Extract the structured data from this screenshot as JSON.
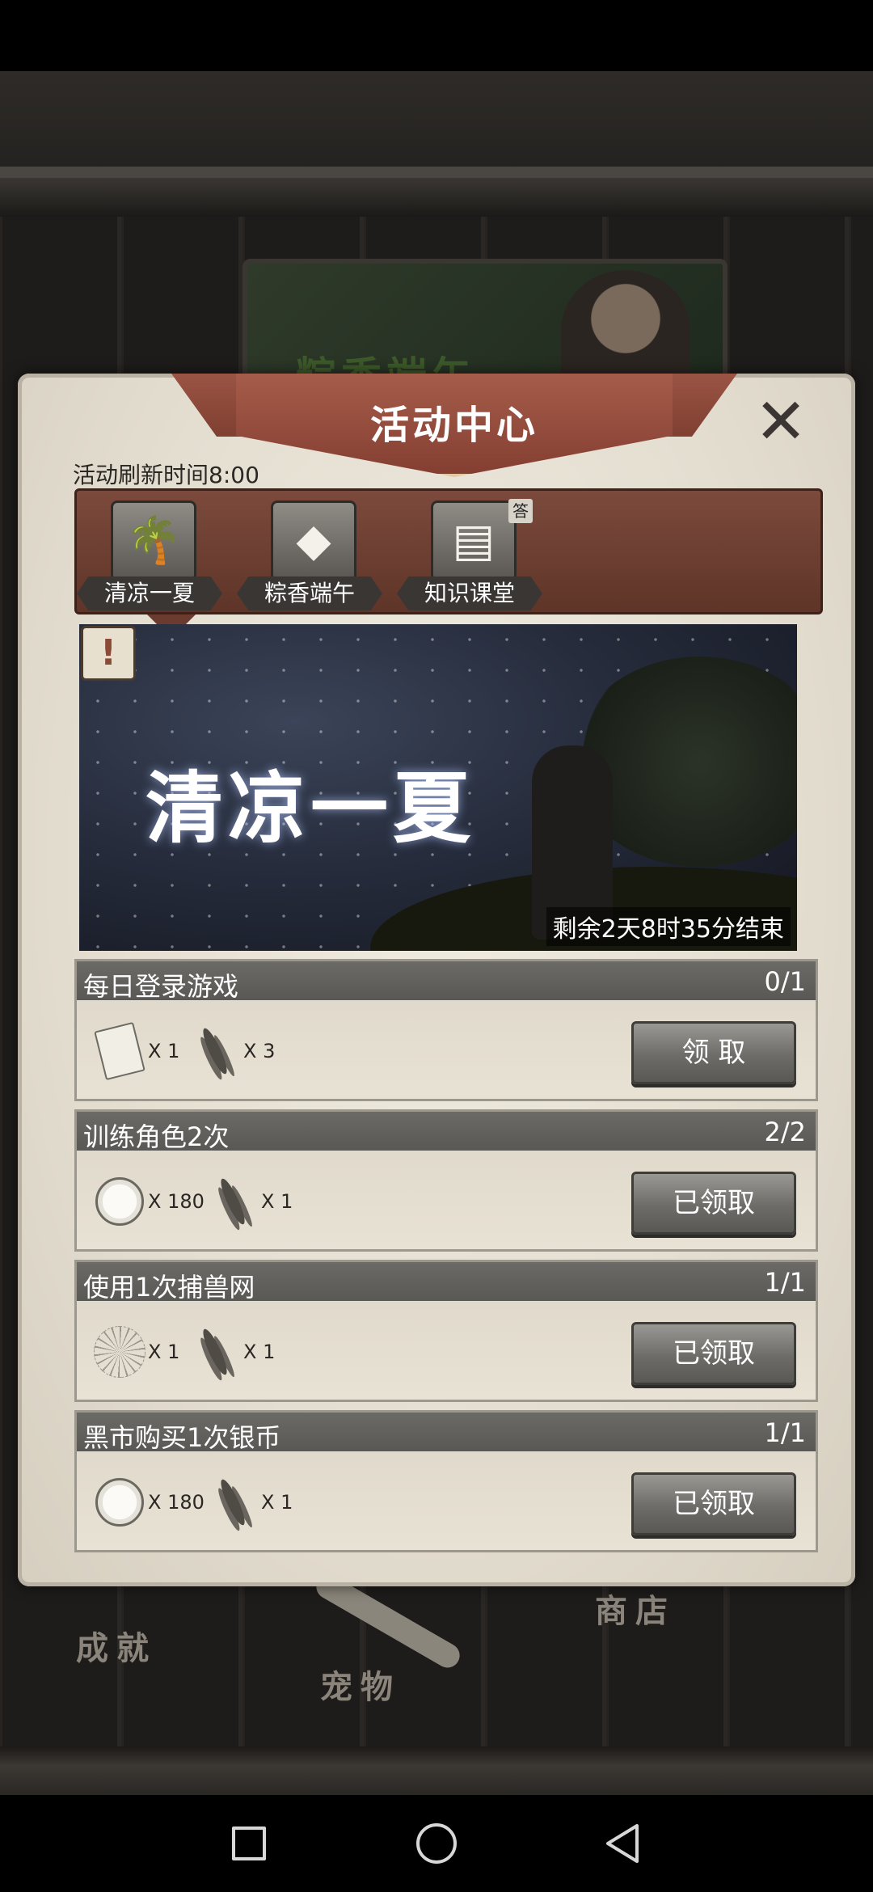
{
  "dialog": {
    "title": "活动中心",
    "close_glyph": "✕",
    "refresh_text": "活动刷新时间8:00"
  },
  "tabs": [
    {
      "label": "清凉一夏",
      "icon": "palm-tree-icon",
      "glyph": "🌴"
    },
    {
      "label": "粽香端午",
      "icon": "zongzi-icon",
      "glyph": "◆"
    },
    {
      "label": "知识课堂",
      "icon": "books-icon",
      "glyph": "▤",
      "badge": "答"
    }
  ],
  "banner": {
    "title": "清凉一夏",
    "timer": "剩余2天8时35分结束",
    "alert": "!"
  },
  "tasks": [
    {
      "title": "每日登录游戏",
      "progress": "0/1",
      "button": "领 取",
      "rewards": [
        {
          "icon": "scroll-icon",
          "qty": "X 1"
        },
        {
          "icon": "feather-icon",
          "qty": "X 3"
        }
      ]
    },
    {
      "title": "训练角色2次",
      "progress": "2/2",
      "button": "已领取",
      "rewards": [
        {
          "icon": "silver-coin-icon",
          "qty": "X 180"
        },
        {
          "icon": "feather-icon",
          "qty": "X 1"
        }
      ]
    },
    {
      "title": "使用1次捕兽网",
      "progress": "1/1",
      "button": "已领取",
      "rewards": [
        {
          "icon": "net-icon",
          "qty": "X 1"
        },
        {
          "icon": "feather-icon",
          "qty": "X 1"
        }
      ]
    },
    {
      "title": "黑市购买1次银币",
      "progress": "1/1",
      "button": "已领取",
      "rewards": [
        {
          "icon": "silver-coin-icon",
          "qty": "X 180"
        },
        {
          "icon": "feather-icon",
          "qty": "X 1"
        }
      ]
    }
  ],
  "background": {
    "banner_title": "粽香端午",
    "labels": {
      "achievement": "成就",
      "pet": "宠物",
      "shop": "商店"
    }
  },
  "nav": {
    "recents": "recents-icon",
    "home": "home-icon",
    "back": "back-icon"
  }
}
